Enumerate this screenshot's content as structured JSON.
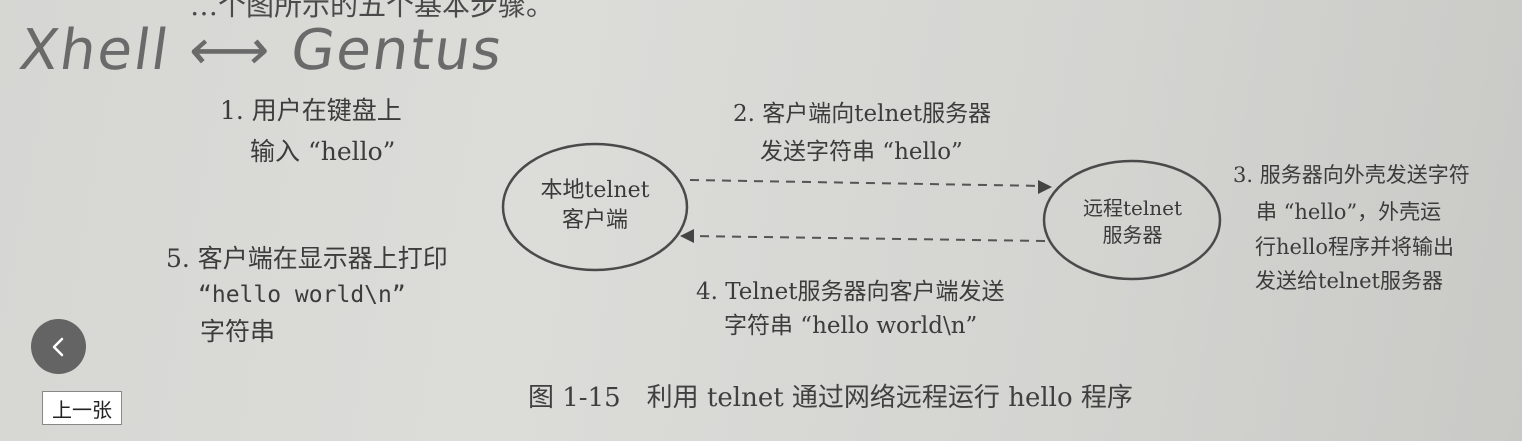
{
  "top_text": "…个图所示的五个基本步骤。",
  "handwriting": "Xhell ⟷ Gentus",
  "steps": {
    "s1_line1": "1. 用户在键盘上",
    "s1_line2": "输入 “hello”",
    "s2_line1": "2. 客户端向telnet服务器",
    "s2_line2": "发送字符串 “hello”",
    "s3_line1": "3. 服务器向外壳发送字符",
    "s3_line2": "串 “hello”，外壳运",
    "s3_line3": "行hello程序并将输出",
    "s3_line4": "发送给telnet服务器",
    "s4_line1": "4. Telnet服务器向客户端发送",
    "s4_line2": "字符串 “hello world\\n”",
    "s5_line1": "5. 客户端在显示器上打印",
    "s5_line2": "“hello world\\n”",
    "s5_line3": "字符串"
  },
  "nodes": {
    "client_line1": "本地telnet",
    "client_line2": "客户端",
    "server_line1": "远程telnet",
    "server_line2": "服务器"
  },
  "caption": "图 1-15　利用 telnet 通过网络远程运行 hello 程序",
  "viewer": {
    "prev_label": "上一张",
    "prev_icon": "chevron-left-icon"
  }
}
